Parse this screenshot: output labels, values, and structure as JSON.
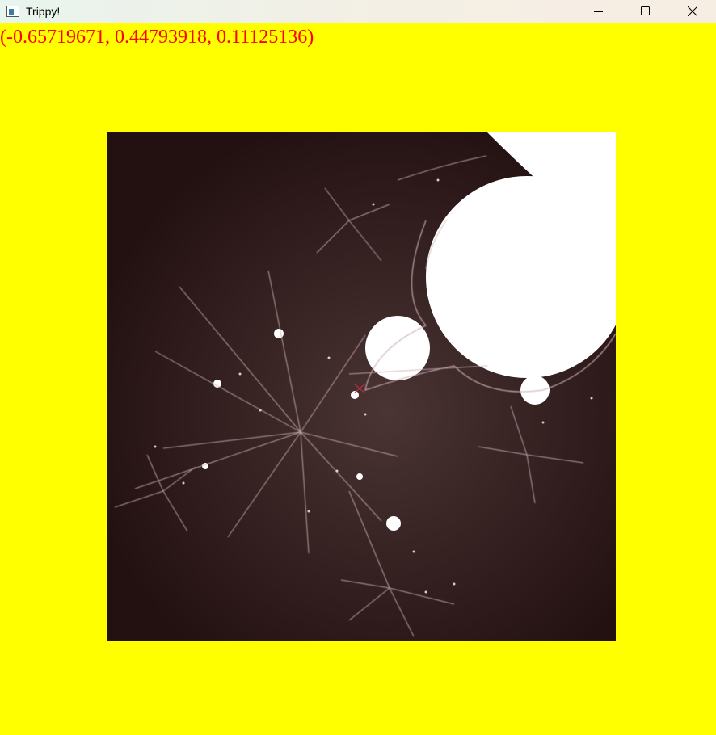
{
  "window": {
    "title": "Trippy!",
    "icon": "app-window-icon",
    "buttons": [
      "minimize-icon",
      "maximize-icon",
      "close-icon"
    ]
  },
  "overlay": {
    "coordinates": "(-0.65719671, 0.44793918, 0.11125136)"
  },
  "colors": {
    "background": "#ffff00",
    "coordinate_text": "#ff0000",
    "fractal_base": "#271313",
    "fractal_interior": "#ffffff",
    "fractal_filament": "#d8b8bc"
  }
}
